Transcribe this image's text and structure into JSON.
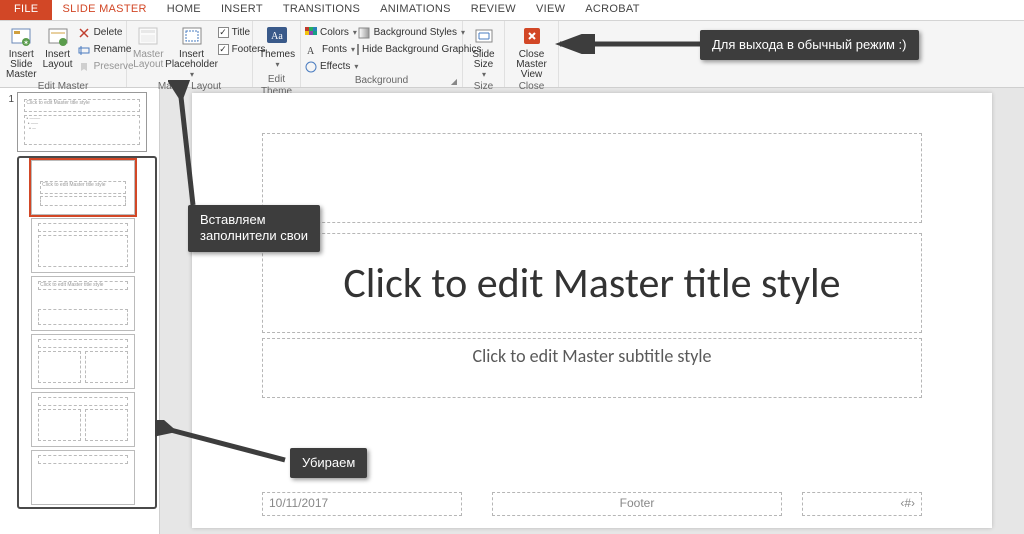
{
  "tabs": {
    "file": "FILE",
    "slide_master": "SLIDE MASTER",
    "home": "HOME",
    "insert": "INSERT",
    "transitions": "TRANSITIONS",
    "animations": "ANIMATIONS",
    "review": "REVIEW",
    "view": "VIEW",
    "acrobat": "ACROBAT"
  },
  "ribbon": {
    "edit_master": {
      "label": "Edit Master",
      "insert_slide_master": "Insert Slide Master",
      "insert_layout": "Insert Layout",
      "delete": "Delete",
      "rename": "Rename",
      "preserve": "Preserve"
    },
    "master_layout": {
      "label": "Master Layout",
      "master_layout_btn": "Master Layout",
      "insert_placeholder": "Insert Placeholder",
      "chk_title": "Title",
      "chk_footers": "Footers"
    },
    "edit_theme": {
      "label": "Edit Theme",
      "themes": "Themes"
    },
    "background": {
      "label": "Background",
      "colors": "Colors",
      "fonts": "Fonts",
      "effects": "Effects",
      "bg_styles": "Background Styles",
      "hide_bg": "Hide Background Graphics"
    },
    "size": {
      "label": "Size",
      "slide_size": "Slide Size"
    },
    "close": {
      "label": "Close",
      "close_mv": "Close Master View"
    }
  },
  "sidebar": {
    "master_num": "1",
    "master_title_txt": "Click to edit Master title style"
  },
  "slide": {
    "title": "Click to edit Master title style",
    "subtitle": "Click to edit Master subtitle style",
    "date": "10/11/2017",
    "footer": "Footer",
    "num": "‹#›"
  },
  "annotations": {
    "close_hint": "Для выхода в обычный режим :)",
    "insert_hint_l1": "Вставляем",
    "insert_hint_l2": "заполнители свои",
    "remove_hint": "Убираем"
  }
}
